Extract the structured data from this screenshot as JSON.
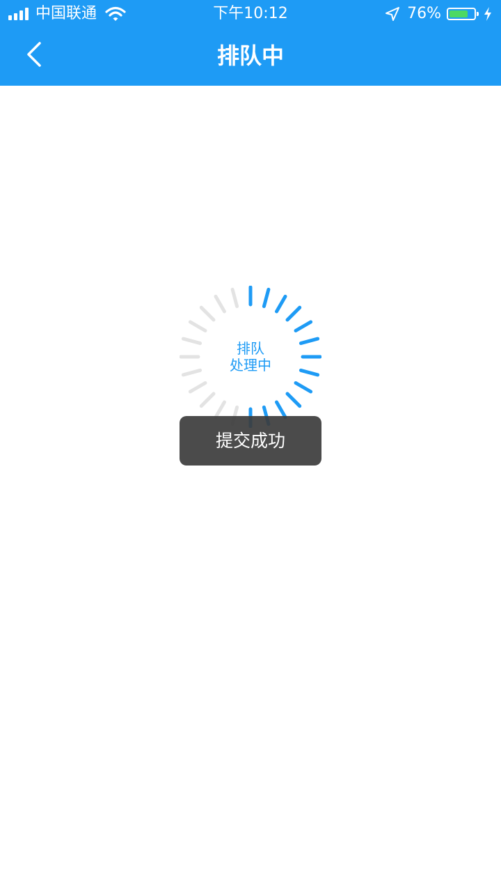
{
  "status_bar": {
    "carrier": "中国联通",
    "time": "下午10:12",
    "battery_percent": "76%",
    "battery_level": 0.76,
    "icons": [
      "signal-icon",
      "wifi-icon",
      "location-icon",
      "battery-icon",
      "charging-icon"
    ]
  },
  "nav": {
    "title": "排队中",
    "back_icon": "chevron-left-icon"
  },
  "spinner": {
    "line1": "排队",
    "line2": "处理中",
    "progress": 0.5,
    "active_color": "#1e9bf5",
    "inactive_color": "#e3e3e3"
  },
  "toast": {
    "text": "提交成功"
  },
  "colors": {
    "brand": "#1e9bf5",
    "toast_bg": "#3c3c3c"
  }
}
